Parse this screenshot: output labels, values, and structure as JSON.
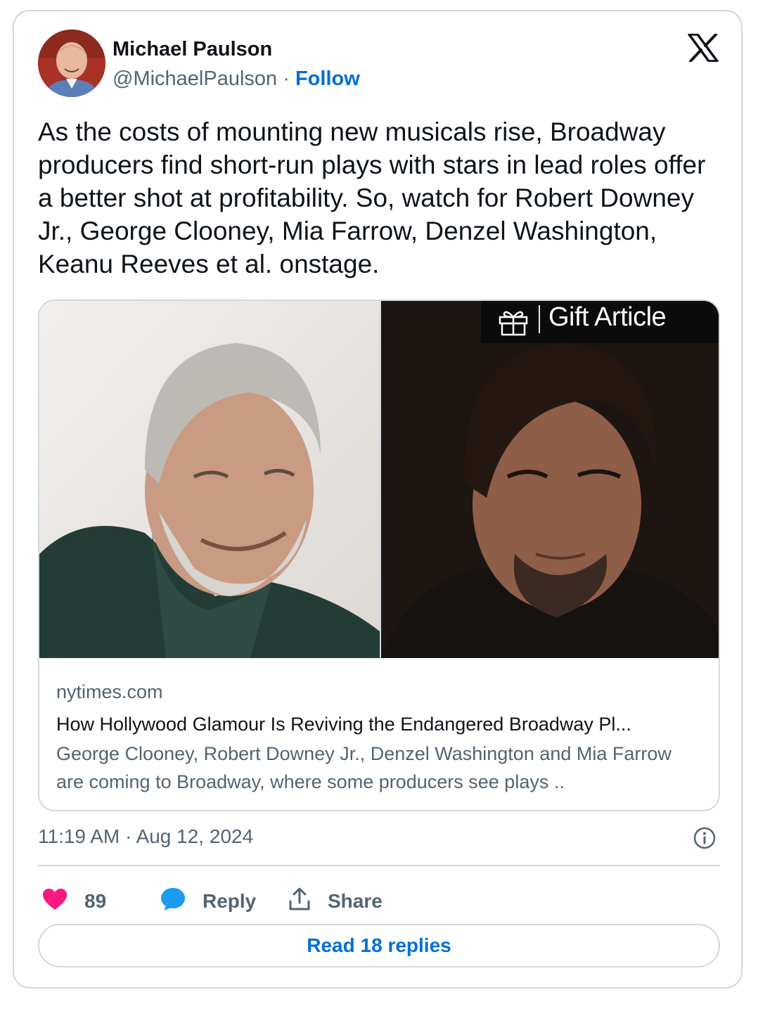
{
  "author": {
    "name": "Michael Paulson",
    "handle": "@MichaelPaulson",
    "separator": " · ",
    "follow_label": "Follow"
  },
  "tweet": {
    "text": "As the costs of mounting new musicals rise, Broadway producers find short-run plays with stars in lead roles offer a better shot at profitability. So, watch for Robert Downey Jr., George Clooney, Mia Farrow, Denzel Washington, Keanu Reeves et al. onstage."
  },
  "card": {
    "gift_label": "Gift Article",
    "domain": "nytimes.com",
    "title": "How Hollywood Glamour Is Reviving the Endangered Broadway Pl...",
    "description": "George Clooney, Robert Downey Jr., Denzel Washington and Mia Farrow are coming to Broadway, where some producers see plays .."
  },
  "meta": {
    "timestamp": "11:19 AM · Aug 12, 2024"
  },
  "actions": {
    "like_count": "89",
    "reply_label": "Reply",
    "share_label": "Share"
  },
  "read_replies_label": "Read 18 replies",
  "colors": {
    "accent": "#006fd6",
    "like": "#f91880",
    "reply_icon": "#1d9bf0",
    "muted": "#536471",
    "border": "#cfd9de"
  },
  "icons": [
    "x-logo-icon",
    "gift-icon",
    "heart-icon",
    "reply-bubble-icon",
    "share-icon",
    "info-icon"
  ]
}
